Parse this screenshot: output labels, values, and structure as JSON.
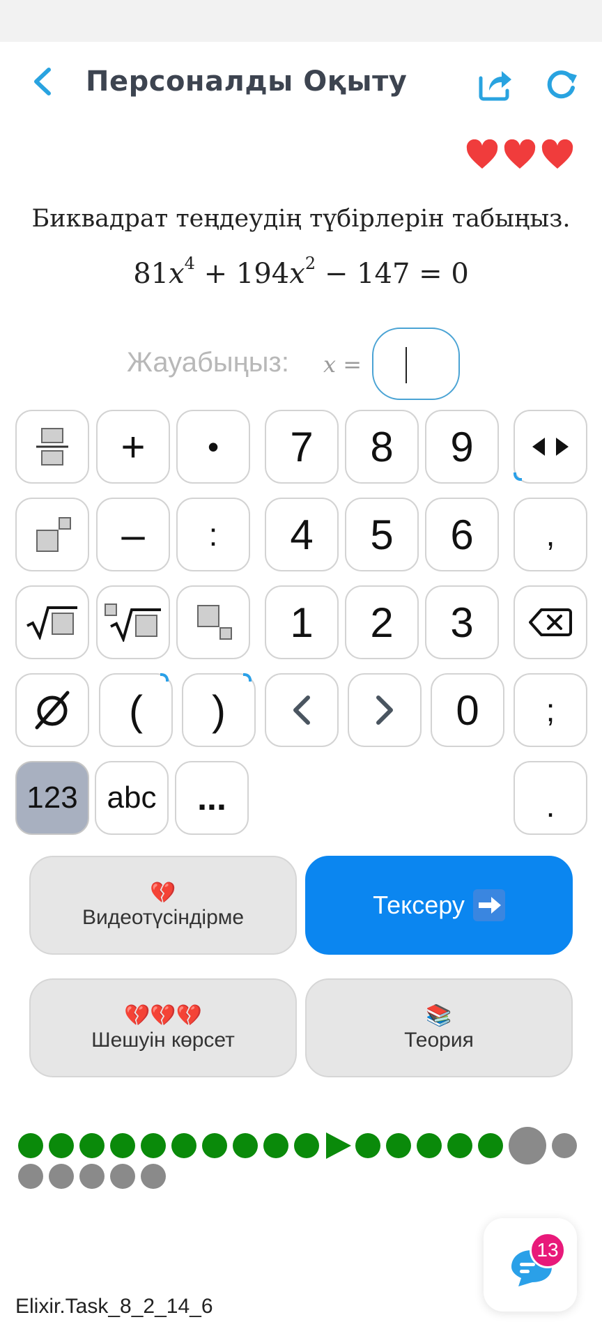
{
  "header": {
    "title": "Персоналды Оқыту"
  },
  "lives": {
    "count": 3,
    "color": "#f03c3c"
  },
  "question": {
    "text": "Биквадрат теңдеудің түбірлерін табыңыз.",
    "formula": {
      "t1_coef": "81",
      "t1_var": "x",
      "t1_exp": "4",
      "op1": "+",
      "t2_coef": "194",
      "t2_var": "x",
      "t2_exp": "2",
      "op2": "−",
      "t3": "147",
      "eq": "=",
      "rhs": "0"
    }
  },
  "answer": {
    "label": "Жауабыңыз:",
    "var_label": "x ="
  },
  "keypad": {
    "plus": "+",
    "dot_mult": "•",
    "seven": "7",
    "eight": "8",
    "nine": "9",
    "minus": "–",
    "colon": ":",
    "four": "4",
    "five": "5",
    "six": "6",
    "comma": ",",
    "one": "1",
    "two": "2",
    "three": "3",
    "paren_open": "(",
    "paren_close": ")",
    "zero": "0",
    "semicolon": ";",
    "mode_numeric": "123",
    "mode_letters": "abc",
    "more": "...",
    "period": "."
  },
  "actions": {
    "video": {
      "emoji": "💔",
      "label": "Видеотүсіндірме"
    },
    "check": {
      "label": "Тексеру"
    },
    "solution": {
      "emoji": "💔💔💔",
      "label": "Шешуін көрсет"
    },
    "theory": {
      "emoji": "📚",
      "label": "Теория"
    }
  },
  "progress": {
    "total": 24,
    "completed": 16,
    "current_index": 17,
    "colors": {
      "done": "#0a8a0a",
      "pending": "#8a8a8a"
    }
  },
  "chat": {
    "badge_count": "13"
  },
  "footer": {
    "task_id": "Elixir.Task_8_2_14_6"
  },
  "colors": {
    "accent": "#0b86f0",
    "header_icons": "#29a3e0"
  }
}
